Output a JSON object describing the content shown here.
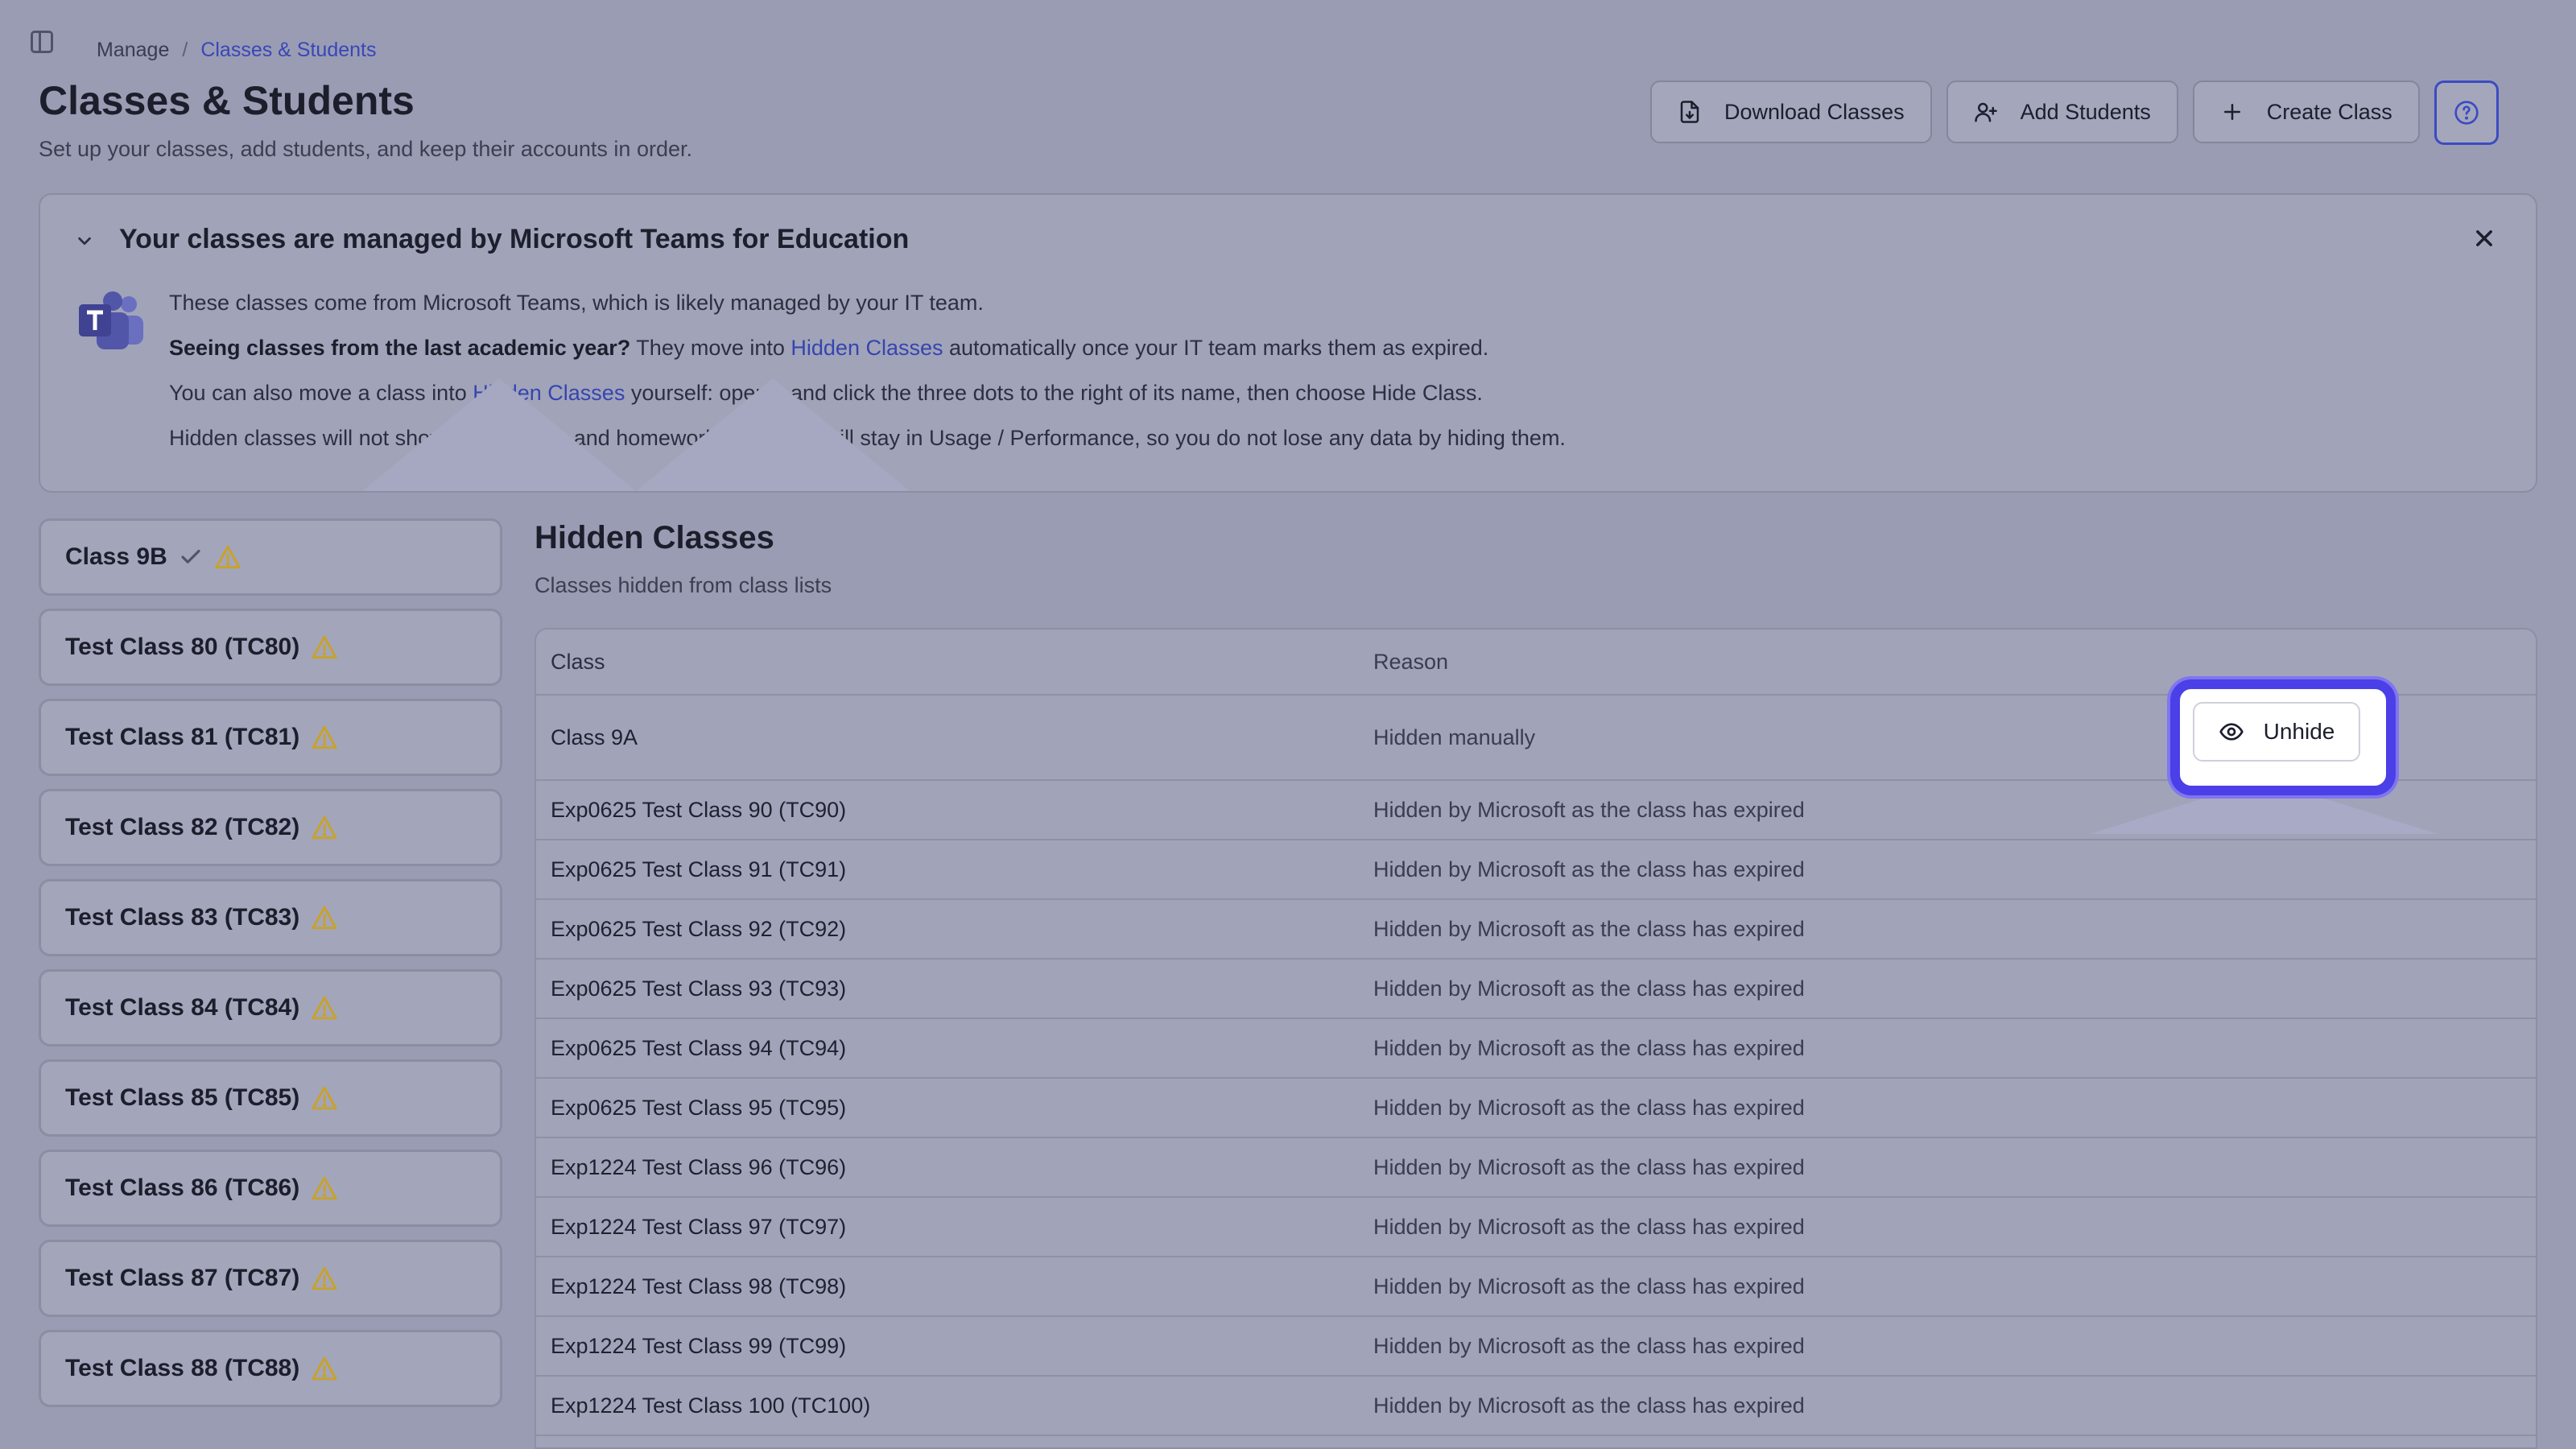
{
  "breadcrumb": {
    "root": "Manage",
    "separator": "/",
    "current": "Classes & Students"
  },
  "page": {
    "title": "Classes & Students",
    "subtitle": "Set up your classes, add students, and keep their accounts in order."
  },
  "toolbar": {
    "download_label": "Download Classes",
    "add_students_label": "Add Students",
    "create_class_label": "Create Class",
    "help_icon": "question-circle-icon"
  },
  "banner": {
    "title": "Your classes are managed by Microsoft Teams for Education",
    "line1": "These classes come from Microsoft Teams, which is likely managed by your IT team.",
    "line2_bold": "Seeing classes from the last academic year?",
    "line2_a": " They move into ",
    "line2_link": "Hidden Classes",
    "line2_b": " automatically once your IT team marks them as expired.",
    "line3_a": "You can also move a class into ",
    "line3_link": "Hidden Classes",
    "line3_b": " yourself: open it and click the three dots to the right of its name, then choose Hide Class.",
    "line4": "Hidden classes will not show on the class and homework pages but will stay in Usage / Performance, so you do not lose any data by hiding them."
  },
  "class_list": [
    "Class 9B",
    "Test Class 80 (TC80)",
    "Test Class 81 (TC81)",
    "Test Class 82 (TC82)",
    "Test Class 83 (TC83)",
    "Test Class 84 (TC84)",
    "Test Class 85 (TC85)",
    "Test Class 86 (TC86)",
    "Test Class 87 (TC87)",
    "Test Class 88 (TC88)"
  ],
  "hidden": {
    "title": "Hidden Classes",
    "subtitle": "Classes hidden from class lists",
    "col_class": "Class",
    "col_reason": "Reason",
    "unhide_label": "Unhide",
    "rows": [
      {
        "class": "Class 9A",
        "reason": "Hidden manually"
      },
      {
        "class": "Exp0625 Test Class 90 (TC90)",
        "reason": "Hidden by Microsoft as the class has expired"
      },
      {
        "class": "Exp0625 Test Class 91 (TC91)",
        "reason": "Hidden by Microsoft as the class has expired"
      },
      {
        "class": "Exp0625 Test Class 92 (TC92)",
        "reason": "Hidden by Microsoft as the class has expired"
      },
      {
        "class": "Exp0625 Test Class 93 (TC93)",
        "reason": "Hidden by Microsoft as the class has expired"
      },
      {
        "class": "Exp0625 Test Class 94 (TC94)",
        "reason": "Hidden by Microsoft as the class has expired"
      },
      {
        "class": "Exp0625 Test Class 95 (TC95)",
        "reason": "Hidden by Microsoft as the class has expired"
      },
      {
        "class": "Exp1224 Test Class 96 (TC96)",
        "reason": "Hidden by Microsoft as the class has expired"
      },
      {
        "class": "Exp1224 Test Class 97 (TC97)",
        "reason": "Hidden by Microsoft as the class has expired"
      },
      {
        "class": "Exp1224 Test Class 98 (TC98)",
        "reason": "Hidden by Microsoft as the class has expired"
      },
      {
        "class": "Exp1224 Test Class 99 (TC99)",
        "reason": "Hidden by Microsoft as the class has expired"
      },
      {
        "class": "Exp1224 Test Class 100 (TC100)",
        "reason": "Hidden by Microsoft as the class has expired"
      }
    ]
  },
  "colors": {
    "accent": "#3545b0",
    "highlight": "#4b3fe8",
    "warning": "#c9a227"
  }
}
